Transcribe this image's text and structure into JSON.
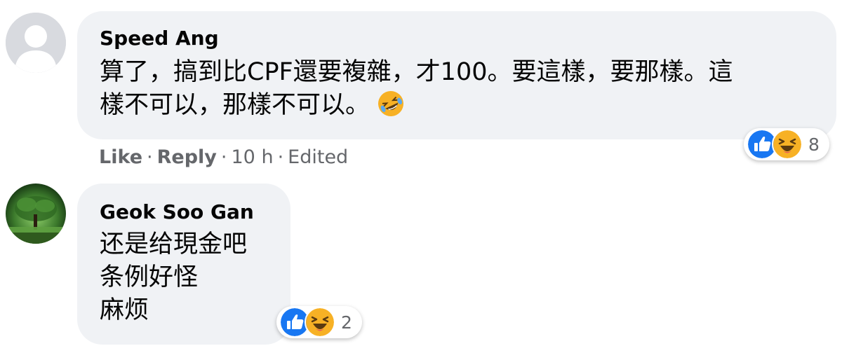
{
  "comments": [
    {
      "author": "Speed Ang",
      "avatar": "default-profile-silhouette",
      "lines": [
        "算了，搞到比CPF還要複雜，才100。要這樣，要那樣。這",
        "樣不可以，那樣不可以。"
      ],
      "inline_emoji": "rolling-on-floor-laughing-icon",
      "actions": {
        "like": "Like",
        "reply": "Reply",
        "time": "10 h",
        "edited": "Edited",
        "separator": "·"
      },
      "reactions": {
        "icons": [
          "like-icon",
          "haha-icon"
        ],
        "count": "8"
      }
    },
    {
      "author": "Geok Soo Gan",
      "avatar": "photo-tree-profile",
      "lines": [
        "还是给現金吧",
        "条例好怪",
        "麻烦"
      ],
      "reactions": {
        "icons": [
          "like-icon",
          "haha-icon"
        ],
        "count": "2"
      }
    }
  ],
  "colors": {
    "bubble": "#f0f2f5",
    "secondary_text": "#65676b",
    "like_blue": "#1877f2",
    "haha_yellow": "#f7b125"
  }
}
